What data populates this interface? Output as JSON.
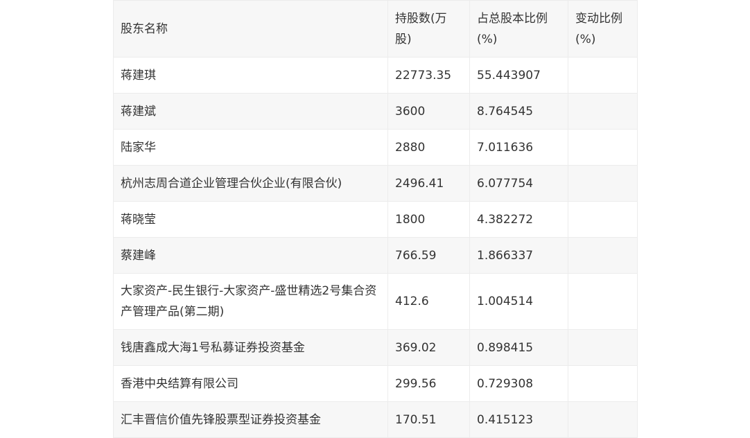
{
  "table": {
    "headers": [
      "股东名称",
      "持股数(万股)",
      "占总股本比例(%)",
      "变动比例(%)"
    ],
    "rows": [
      [
        "蒋建琪",
        "22773.35",
        "55.443907",
        ""
      ],
      [
        "蒋建斌",
        "3600",
        "8.764545",
        ""
      ],
      [
        "陆家华",
        "2880",
        "7.011636",
        ""
      ],
      [
        "杭州志周合道企业管理合伙企业(有限合伙)",
        "2496.41",
        "6.077754",
        ""
      ],
      [
        "蒋晓莹",
        "1800",
        "4.382272",
        ""
      ],
      [
        "蔡建峰",
        "766.59",
        "1.866337",
        ""
      ],
      [
        "大家资产-民生银行-大家资产-盛世精选2号集合资产管理产品(第二期)",
        "412.6",
        "1.004514",
        ""
      ],
      [
        "钱唐鑫成大海1号私募证券投资基金",
        "369.02",
        "0.898415",
        ""
      ],
      [
        "香港中央结算有限公司",
        "299.56",
        "0.729308",
        ""
      ],
      [
        "汇丰晋信价值先锋股票型证券投资基金",
        "170.51",
        "0.415123",
        ""
      ]
    ]
  }
}
